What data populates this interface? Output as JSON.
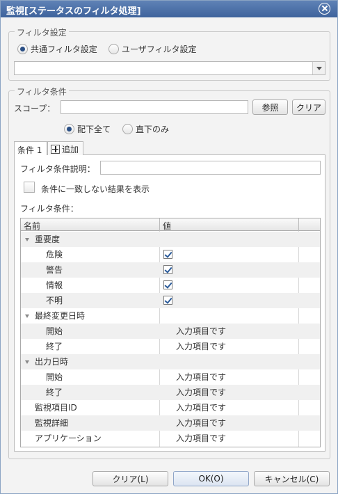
{
  "window": {
    "title": "監視[ステータスのフィルタ処理]"
  },
  "filter_settings": {
    "legend": "フィルタ設定",
    "options": [
      {
        "label": "共通フィルタ設定",
        "selected": true
      },
      {
        "label": "ユーザフィルタ設定",
        "selected": false
      }
    ],
    "filter_select": {
      "value": ""
    }
  },
  "filter_conditions": {
    "legend": "フィルタ条件",
    "scope_label": "スコープ：",
    "scope_value": "",
    "browse_button": "参照",
    "clear_button": "クリア",
    "scope_options": [
      {
        "label": "配下全て",
        "selected": true
      },
      {
        "label": "直下のみ",
        "selected": false
      }
    ],
    "tabs": [
      {
        "label": "条件 1"
      }
    ],
    "add_tab_label": "追加",
    "description_label": "フィルタ条件説明：",
    "description_value": "",
    "show_unmatched_label": "条件に一致しない結果を表示",
    "show_unmatched_checked": false,
    "conditions_label": "フィルタ条件：",
    "grid": {
      "columns": [
        "名前",
        "値"
      ],
      "rows": [
        {
          "name": "重要度",
          "value": "",
          "level": 0,
          "group": true
        },
        {
          "name": "危険",
          "value": "",
          "level": 1,
          "checked": true
        },
        {
          "name": "警告",
          "value": "",
          "level": 1,
          "checked": true
        },
        {
          "name": "情報",
          "value": "",
          "level": 1,
          "checked": true
        },
        {
          "name": "不明",
          "value": "",
          "level": 1,
          "checked": true
        },
        {
          "name": "最終変更日時",
          "value": "",
          "level": 0,
          "group": true
        },
        {
          "name": "開始",
          "value": "入力項目です",
          "level": 1
        },
        {
          "name": "終了",
          "value": "入力項目です",
          "level": 1
        },
        {
          "name": "出力日時",
          "value": "",
          "level": 0,
          "group": true
        },
        {
          "name": "開始",
          "value": "入力項目です",
          "level": 1
        },
        {
          "name": "終了",
          "value": "入力項目です",
          "level": 1
        },
        {
          "name": "監視項目ID",
          "value": "入力項目です",
          "level": 0
        },
        {
          "name": "監視詳細",
          "value": "入力項目です",
          "level": 0
        },
        {
          "name": "アプリケーション",
          "value": "入力項目です",
          "level": 0
        }
      ]
    }
  },
  "footer": {
    "clear_button": "クリア(L)",
    "ok_button": "OK(O)",
    "cancel_button": "キャンセル(C)"
  },
  "colors": {
    "title_bar": "#4a6fa8",
    "check": "#2b5b9a",
    "radio_selected": "#2a4f85"
  }
}
